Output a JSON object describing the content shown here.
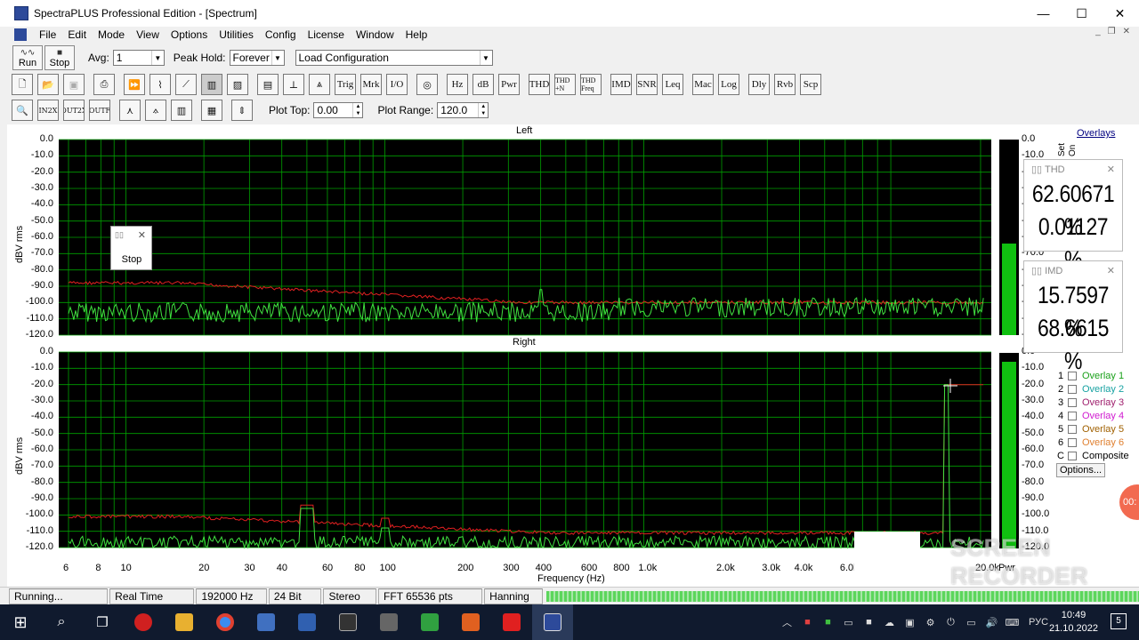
{
  "window": {
    "title": "SpectraPLUS Professional Edition - [Spectrum]",
    "min": "—",
    "max": "☐",
    "close": "✕"
  },
  "menu": [
    "File",
    "Edit",
    "Mode",
    "View",
    "Options",
    "Utilities",
    "Config",
    "License",
    "Window",
    "Help"
  ],
  "mdi": {
    "min": "_",
    "restore": "❐",
    "close": "✕"
  },
  "toolbar1": {
    "run": "Run",
    "stop": "Stop",
    "avg_label": "Avg:",
    "avg_value": "1",
    "peak_label": "Peak Hold:",
    "peak_value": "Forever",
    "load_config": "Load Configuration"
  },
  "toolbar2": {
    "buttons_text": [
      "Trig",
      "Mrk",
      "I/O",
      "Hz",
      "dB",
      "Pwr",
      "THD",
      "THD +N",
      "THD Freq",
      "IMD",
      "SNR",
      "Leq",
      "Mac",
      "Log",
      "Dly",
      "Rvb",
      "Scp"
    ]
  },
  "toolbar3": {
    "plot_top_label": "Plot Top:",
    "plot_top_value": "0.00",
    "plot_range_label": "Plot Range:",
    "plot_range_value": "120.0"
  },
  "plots": {
    "left_title": "Left",
    "right_title": "Right",
    "ylabel": "dBV rms",
    "xlabel": "Frequency (Hz)",
    "y_ticks": [
      "0.0",
      "-10.0",
      "-20.0",
      "-30.0",
      "-40.0",
      "-50.0",
      "-60.0",
      "-70.0",
      "-80.0",
      "-90.0",
      "-100.0",
      "-110.0",
      "-120.0"
    ],
    "x_ticks": [
      "6",
      "8",
      "10",
      "20",
      "30",
      "40",
      "60",
      "80",
      "100",
      "200",
      "300",
      "400",
      "600",
      "800",
      "1.0k",
      "2.0k",
      "3.0k",
      "4.0k",
      "6.0k",
      "20.0k"
    ],
    "pwr_label": "Pwr"
  },
  "side": {
    "overlays_link": "Overlays",
    "set_label": "Set",
    "on_label": "On",
    "thd_title": "THD",
    "thd_value1": "62.60671 %",
    "thd_value2": "0.01127 %",
    "imd_title": "IMD",
    "imd_value1": "15.7597 %",
    "imd_value2": "68.6615 %",
    "overlays": [
      {
        "n": "1",
        "label": "Overlay 1",
        "color": "#1aa01a"
      },
      {
        "n": "2",
        "label": "Overlay 2",
        "color": "#17a2a2"
      },
      {
        "n": "3",
        "label": "Overlay 3",
        "color": "#a0206e"
      },
      {
        "n": "4",
        "label": "Overlay 4",
        "color": "#d01ad0"
      },
      {
        "n": "5",
        "label": "Overlay 5",
        "color": "#a06000"
      },
      {
        "n": "6",
        "label": "Overlay 6",
        "color": "#e08030"
      },
      {
        "n": "C",
        "label": "Composite",
        "color": "#000000"
      }
    ],
    "options_btn": "Options...",
    "meter_ticks": [
      "0.0",
      "-10.0",
      "-20.0",
      "-30.0",
      "-40.0",
      "-50.0",
      "-60.0",
      "-70.0",
      "-80.0",
      "-90.0",
      "-100.0",
      "-110.0",
      "-120.0"
    ]
  },
  "stop_window": {
    "label": "Stop"
  },
  "status": {
    "state": "Running...",
    "mode": "Real Time",
    "rate": "192000 Hz",
    "bits": "24 Bit",
    "channels": "Stereo",
    "fft": "FFT 65536 pts",
    "window": "Hanning"
  },
  "taskbar": {
    "lang": "РУС",
    "time": "10:49",
    "date": "21.10.2022",
    "notif": "5"
  },
  "watermark": {
    "line1": "SCREEN",
    "line2": "RECORDER",
    "rec": "00:"
  },
  "colors": {
    "grid": "#00a000",
    "trace_red": "#e02020",
    "trace_green": "#40e040",
    "plot_bg": "#000000",
    "meter_fill": "#10c010"
  }
}
